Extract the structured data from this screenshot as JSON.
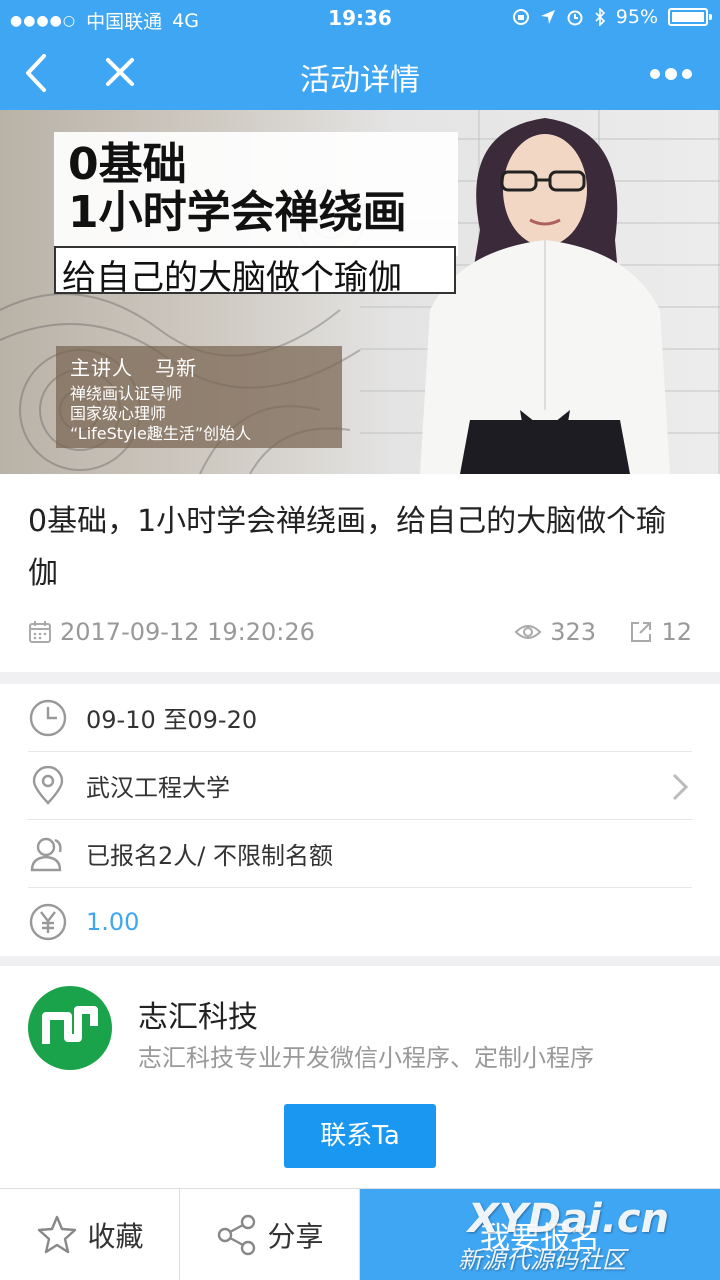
{
  "status_bar": {
    "signal_dots": "●●●●○",
    "carrier": "中国联通",
    "network": "4G",
    "time": "19:36",
    "battery": "95%"
  },
  "nav": {
    "title": "活动详情",
    "back_icon": "chevron-left-icon",
    "close_icon": "close-icon",
    "more_icon": "more-dots-icon"
  },
  "banner": {
    "headline_line1": "0基础",
    "headline_line2": "1小时学会禅绕画",
    "subline": "给自己的大脑做个瑜伽",
    "host_label": "主讲人",
    "host_name": "马新",
    "host_titles": [
      "禅绕画认证导师",
      "国家级心理师",
      "“LifeStyle趣生活”创始人"
    ]
  },
  "activity": {
    "title": "0基础，1小时学会禅绕画，给自己的大脑做个瑜伽",
    "date": "2017-09-12 19:20:26",
    "views": "323",
    "shares": "12"
  },
  "details": {
    "time_range": "09-10 至09-20",
    "location": "武汉工程大学",
    "signup": "已报名2人/ 不限制名额",
    "price": "1.00"
  },
  "organizer": {
    "name": "志汇科技",
    "description": "志汇科技专业开发微信小程序、定制小程序",
    "contact_label": "联系Ta"
  },
  "bottom_bar": {
    "favorite_label": "收藏",
    "share_label": "分享",
    "signup_label": "我要报名"
  },
  "watermark": {
    "line1": "XYDai.cn",
    "line2": "新源代源码社区"
  },
  "colors": {
    "primary": "#3fa6f4",
    "button": "#1a97f0",
    "logo_green": "#1aa34a",
    "muted_text": "#999999"
  }
}
